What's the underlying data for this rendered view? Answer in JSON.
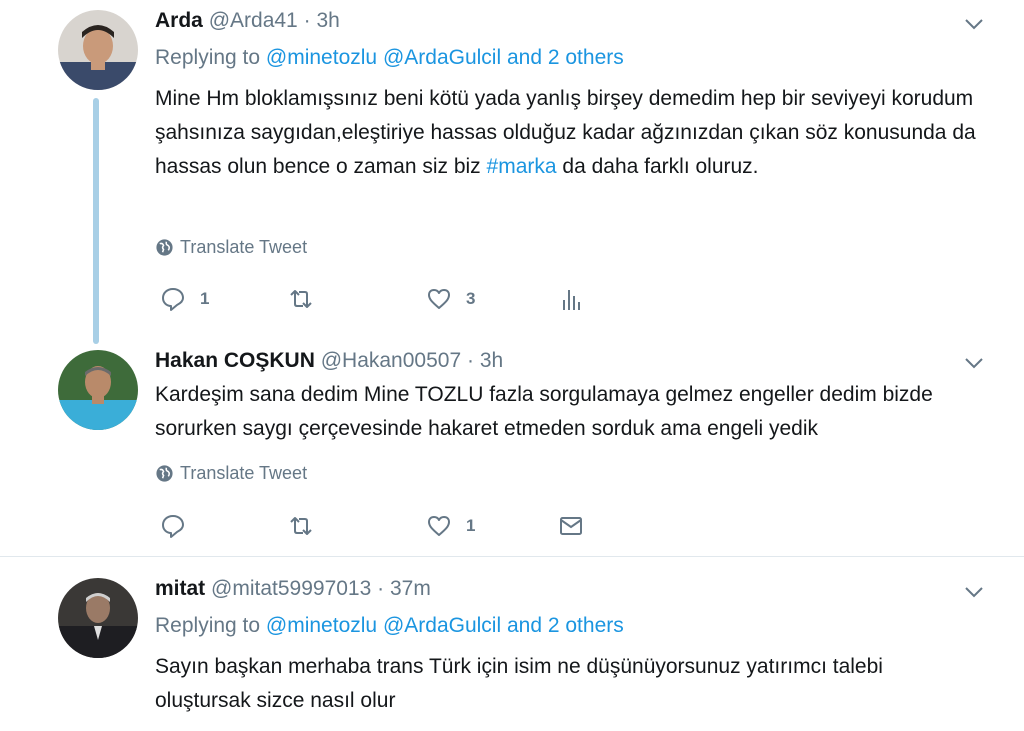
{
  "tweets": [
    {
      "name": "Arda",
      "handle": "@Arda41",
      "dot": "·",
      "time": "3h",
      "replying_prefix": "Replying to",
      "replying_to": [
        "@minetozlu",
        "@ArdaGulcil"
      ],
      "replying_suffix": "and 2 others",
      "text_before": "Mine Hm bloklamışsınız beni kötü yada yanlış birşey demedim hep bir seviyeyi korudum şahsınıza saygıdan,eleştiriye hassas olduğuz kadar ağzınızdan çıkan söz konusunda da hassas olun bence o zaman siz biz ",
      "hashtag": "#marka",
      "text_after": " da daha farklı oluruz.",
      "translate": "Translate Tweet",
      "reply_count": "1",
      "like_count": "3"
    },
    {
      "name": "Hakan COŞKUN",
      "handle": "@Hakan00507",
      "dot": "·",
      "time": "3h",
      "text": "Kardeşim sana dedim Mine TOZLU fazla sorgulamaya gelmez engeller dedim bizde sorurken saygı çerçevesinde hakaret etmeden sorduk ama engeli yedik",
      "translate": "Translate Tweet",
      "like_count": "1"
    },
    {
      "name": "mitat",
      "handle": "@mitat59997013",
      "dot": "·",
      "time": "37m",
      "replying_prefix": "Replying to",
      "replying_to": [
        "@minetozlu",
        "@ArdaGulcil"
      ],
      "replying_suffix": "and 2 others",
      "text": "Sayın başkan merhaba trans Türk için isim ne düşünüyorsunuz yatırımcı talebi oluştursak sizce nasıl olur"
    }
  ],
  "colors": {
    "link": "#1b95e0",
    "muted": "#657786",
    "thread": "#a8cfe6"
  },
  "icons": [
    "chevron-down-icon",
    "globe-icon",
    "reply-icon",
    "retweet-icon",
    "like-icon",
    "analytics-icon",
    "mail-icon"
  ]
}
